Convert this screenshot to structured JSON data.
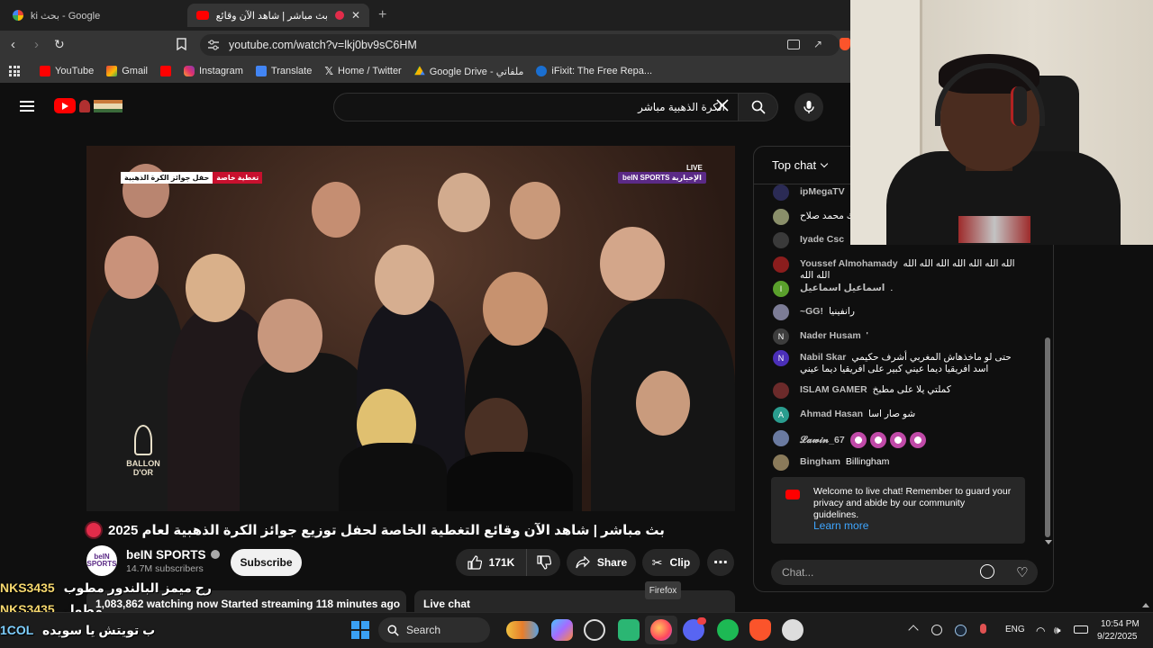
{
  "browser": {
    "tabs": [
      {
        "title": "ki بحث - Google"
      },
      {
        "title": "بث مباشر | شاهد الآن وقائع الت"
      }
    ],
    "url": "youtube.com/watch?v=lkj0bv9sC6HM",
    "bookmarks": [
      {
        "label": "YouTube"
      },
      {
        "label": "Gmail"
      },
      {
        "label": "Instagram"
      },
      {
        "label": "Translate"
      },
      {
        "label": "Home / Twitter"
      },
      {
        "label": "Google Drive - ملفاتي"
      },
      {
        "label": "iFixit: The Free Repa..."
      }
    ]
  },
  "youtube": {
    "search_query": "الكرة الذهبية مباشر"
  },
  "video": {
    "overlay_left_badge": "تغطية خاصة",
    "overlay_left_text": "حفل جوائز الكرة الذهبية",
    "live_label": "LIVE",
    "channel_bug": "beIN SPORTS الإخبارية",
    "ballon_dor": "BALLON D'OR"
  },
  "meta": {
    "title": "بث مباشر | شاهد الآن وقائع التغطية الخاصة لحفل توزيع جوائز الكرة الذهبية لعام 2025",
    "channel_name": "beIN SPORTS",
    "avatar_text": "beIN SPORTS",
    "subscribers": "14.7M subscribers",
    "subscribe_label": "Subscribe",
    "likes": "171K",
    "share_label": "Share",
    "clip_label": "Clip",
    "watching": "1,083,862 watching now  Started streaming 118 minutes ago",
    "live_chat_label": "Live chat",
    "tooltip": "Firefox"
  },
  "chat": {
    "header": "Top chat",
    "messages": [
      {
        "author": "ipMegaTV",
        "text": "",
        "avatar_letter": "",
        "avatar_color": "#2b2b55"
      },
      {
        "author": "",
        "text": "مبارك محمد صلاح",
        "avatar_letter": "",
        "avatar_color": "#8a8f6a"
      },
      {
        "author": "Iyade Csc",
        "text": "",
        "avatar_letter": "",
        "avatar_color": "#3a3a3a"
      },
      {
        "author": "Youssef Almohamady",
        "text": "الله الله الله الله الله الله الله الله الله",
        "avatar_letter": "",
        "avatar_color": "#8b1d1d"
      },
      {
        "author": "اسماعيل اسماعيل",
        "text": ".",
        "avatar_letter": "I",
        "avatar_color": "#5aa02c"
      },
      {
        "author": "~GG!",
        "text": "رانفينيا",
        "avatar_letter": "",
        "avatar_color": "#7c7c96"
      },
      {
        "author": "Nader Husam",
        "text": "'",
        "avatar_letter": "N",
        "avatar_color": "#3d3d3d"
      },
      {
        "author": "Nabil Skar",
        "text": "حتى لو ماخذهاش المغربي أشرف حكيمي اسد افريقيا ديما عيني كبير على افريقيا ديما عيني",
        "avatar_letter": "N",
        "avatar_color": "#4b2fb8"
      },
      {
        "author": "ISLAM GAMER",
        "text": "كملتي يلا على مطبخ",
        "avatar_letter": "",
        "avatar_color": "#6b2a2a"
      },
      {
        "author": "Ahmad Hasan",
        "text": "شو صار اسا",
        "avatar_letter": "A",
        "avatar_color": "#2a9d8f"
      },
      {
        "author": "𝓛𝓪𝔀𝓲𝓷_67",
        "text": "",
        "avatar_letter": "",
        "avatar_color": "#6a7aa0"
      },
      {
        "author": "Bingham",
        "text": "Billingham",
        "avatar_letter": "",
        "avatar_color": "#8a7a5a"
      }
    ],
    "welcome_text": "Welcome to live chat! Remember to guard your privacy and abide by our community guidelines.",
    "learn_more": "Learn more",
    "input_placeholder": "Chat..."
  },
  "stream_overlay": {
    "line1_user": "NKS3435",
    "line1_text": "رح ميمز البالندور مطوب",
    "line2_user": "NKS3435",
    "line2_text": "مطول",
    "line3_user": "1COL",
    "line3_text": "ب تويتش يا سويده"
  },
  "taskbar": {
    "search_label": "Search",
    "language": "ENG",
    "time": "10:54 PM",
    "date": "9/22/2025"
  },
  "colors": {
    "youtube_red": "#ff0000",
    "live_dot": "#e22c4a",
    "link_blue": "#3ea6ff"
  }
}
